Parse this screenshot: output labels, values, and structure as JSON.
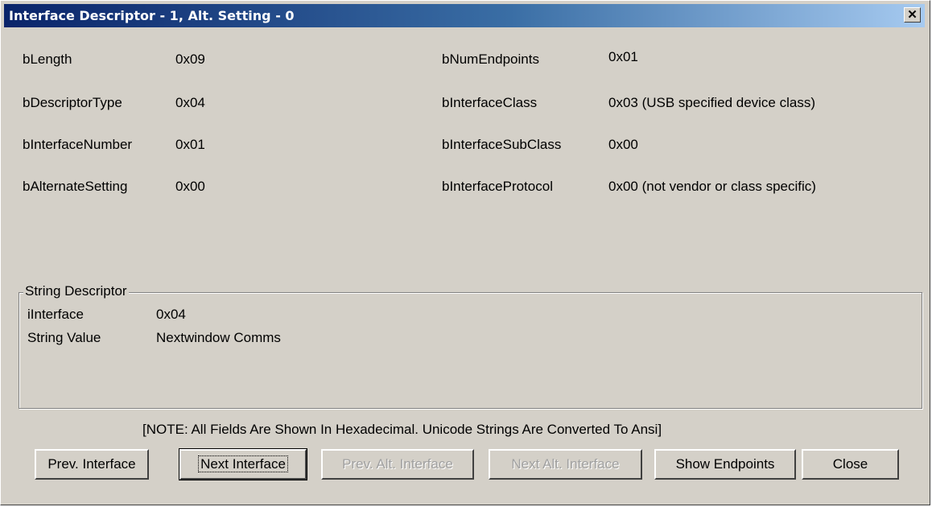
{
  "window": {
    "title": "Interface Descriptor - 1, Alt. Setting - 0",
    "close_glyph": "✕"
  },
  "fields_left": [
    {
      "name": "bLength",
      "value": "0x09"
    },
    {
      "name": "bDescriptorType",
      "value": "0x04"
    },
    {
      "name": "bInterfaceNumber",
      "value": "0x01"
    },
    {
      "name": "bAlternateSetting",
      "value": "0x00"
    }
  ],
  "fields_right": [
    {
      "name": "bNumEndpoints",
      "value": "0x01"
    },
    {
      "name": "bInterfaceClass",
      "value": "0x03 (USB specified device class)"
    },
    {
      "name": "bInterfaceSubClass",
      "value": "0x00"
    },
    {
      "name": "bInterfaceProtocol",
      "value": "0x00 (not vendor or class specific)"
    }
  ],
  "string_descriptor": {
    "title": "String Descriptor",
    "rows": [
      {
        "name": "iInterface",
        "value": "0x04"
      },
      {
        "name": "String Value",
        "value": "Nextwindow Comms"
      }
    ]
  },
  "note": "[NOTE: All Fields Are Shown In Hexadecimal.   Unicode Strings Are Converted To Ansi]",
  "buttons": {
    "prev_interface": "Prev. Interface",
    "next_interface": "Next Interface",
    "prev_alt_interface": "Prev. Alt. Interface",
    "next_alt_interface": "Next Alt. Interface",
    "show_endpoints": "Show Endpoints",
    "close": "Close"
  }
}
